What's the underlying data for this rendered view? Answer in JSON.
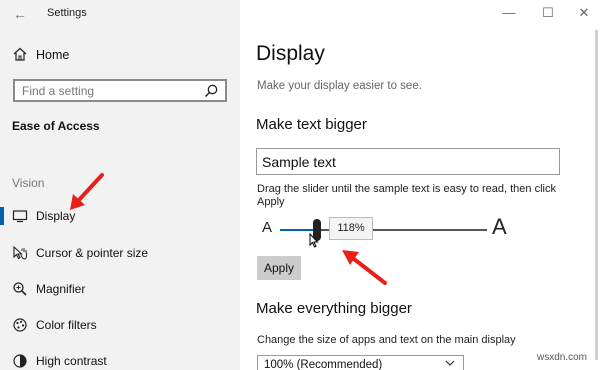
{
  "window": {
    "title": "Settings",
    "back_glyph": "←",
    "minimize_glyph": "—",
    "maximize_glyph": "☐",
    "close_glyph": "✕"
  },
  "sidebar": {
    "home_label": "Home",
    "search_placeholder": "Find a setting",
    "section_title": "Ease of Access",
    "group_label": "Vision",
    "items": [
      {
        "label": "Display",
        "icon": "monitor-icon",
        "selected": true
      },
      {
        "label": "Cursor & pointer size",
        "icon": "cursor-pointer-icon",
        "selected": false
      },
      {
        "label": "Magnifier",
        "icon": "magnifier-icon",
        "selected": false
      },
      {
        "label": "Color filters",
        "icon": "color-filters-icon",
        "selected": false
      },
      {
        "label": "High contrast",
        "icon": "high-contrast-icon",
        "selected": false
      }
    ]
  },
  "main": {
    "title": "Display",
    "subtitle": "Make your display easier to see.",
    "text_bigger": {
      "heading": "Make text bigger",
      "sample_text": "Sample text",
      "help": "Drag the slider until the sample text is easy to read, then click Apply",
      "slider_min_label": "A",
      "slider_max_label": "A",
      "slider_value_text": "118%",
      "slider_fraction": 0.18,
      "apply_label": "Apply"
    },
    "everything_bigger": {
      "heading": "Make everything bigger",
      "help": "Change the size of apps and text on the main display",
      "dropdown_value": "100% (Recommended)"
    }
  },
  "watermark": "wsxdn.com",
  "colors": {
    "accent": "#0063b1",
    "annotation_arrow": "#e8201c"
  }
}
